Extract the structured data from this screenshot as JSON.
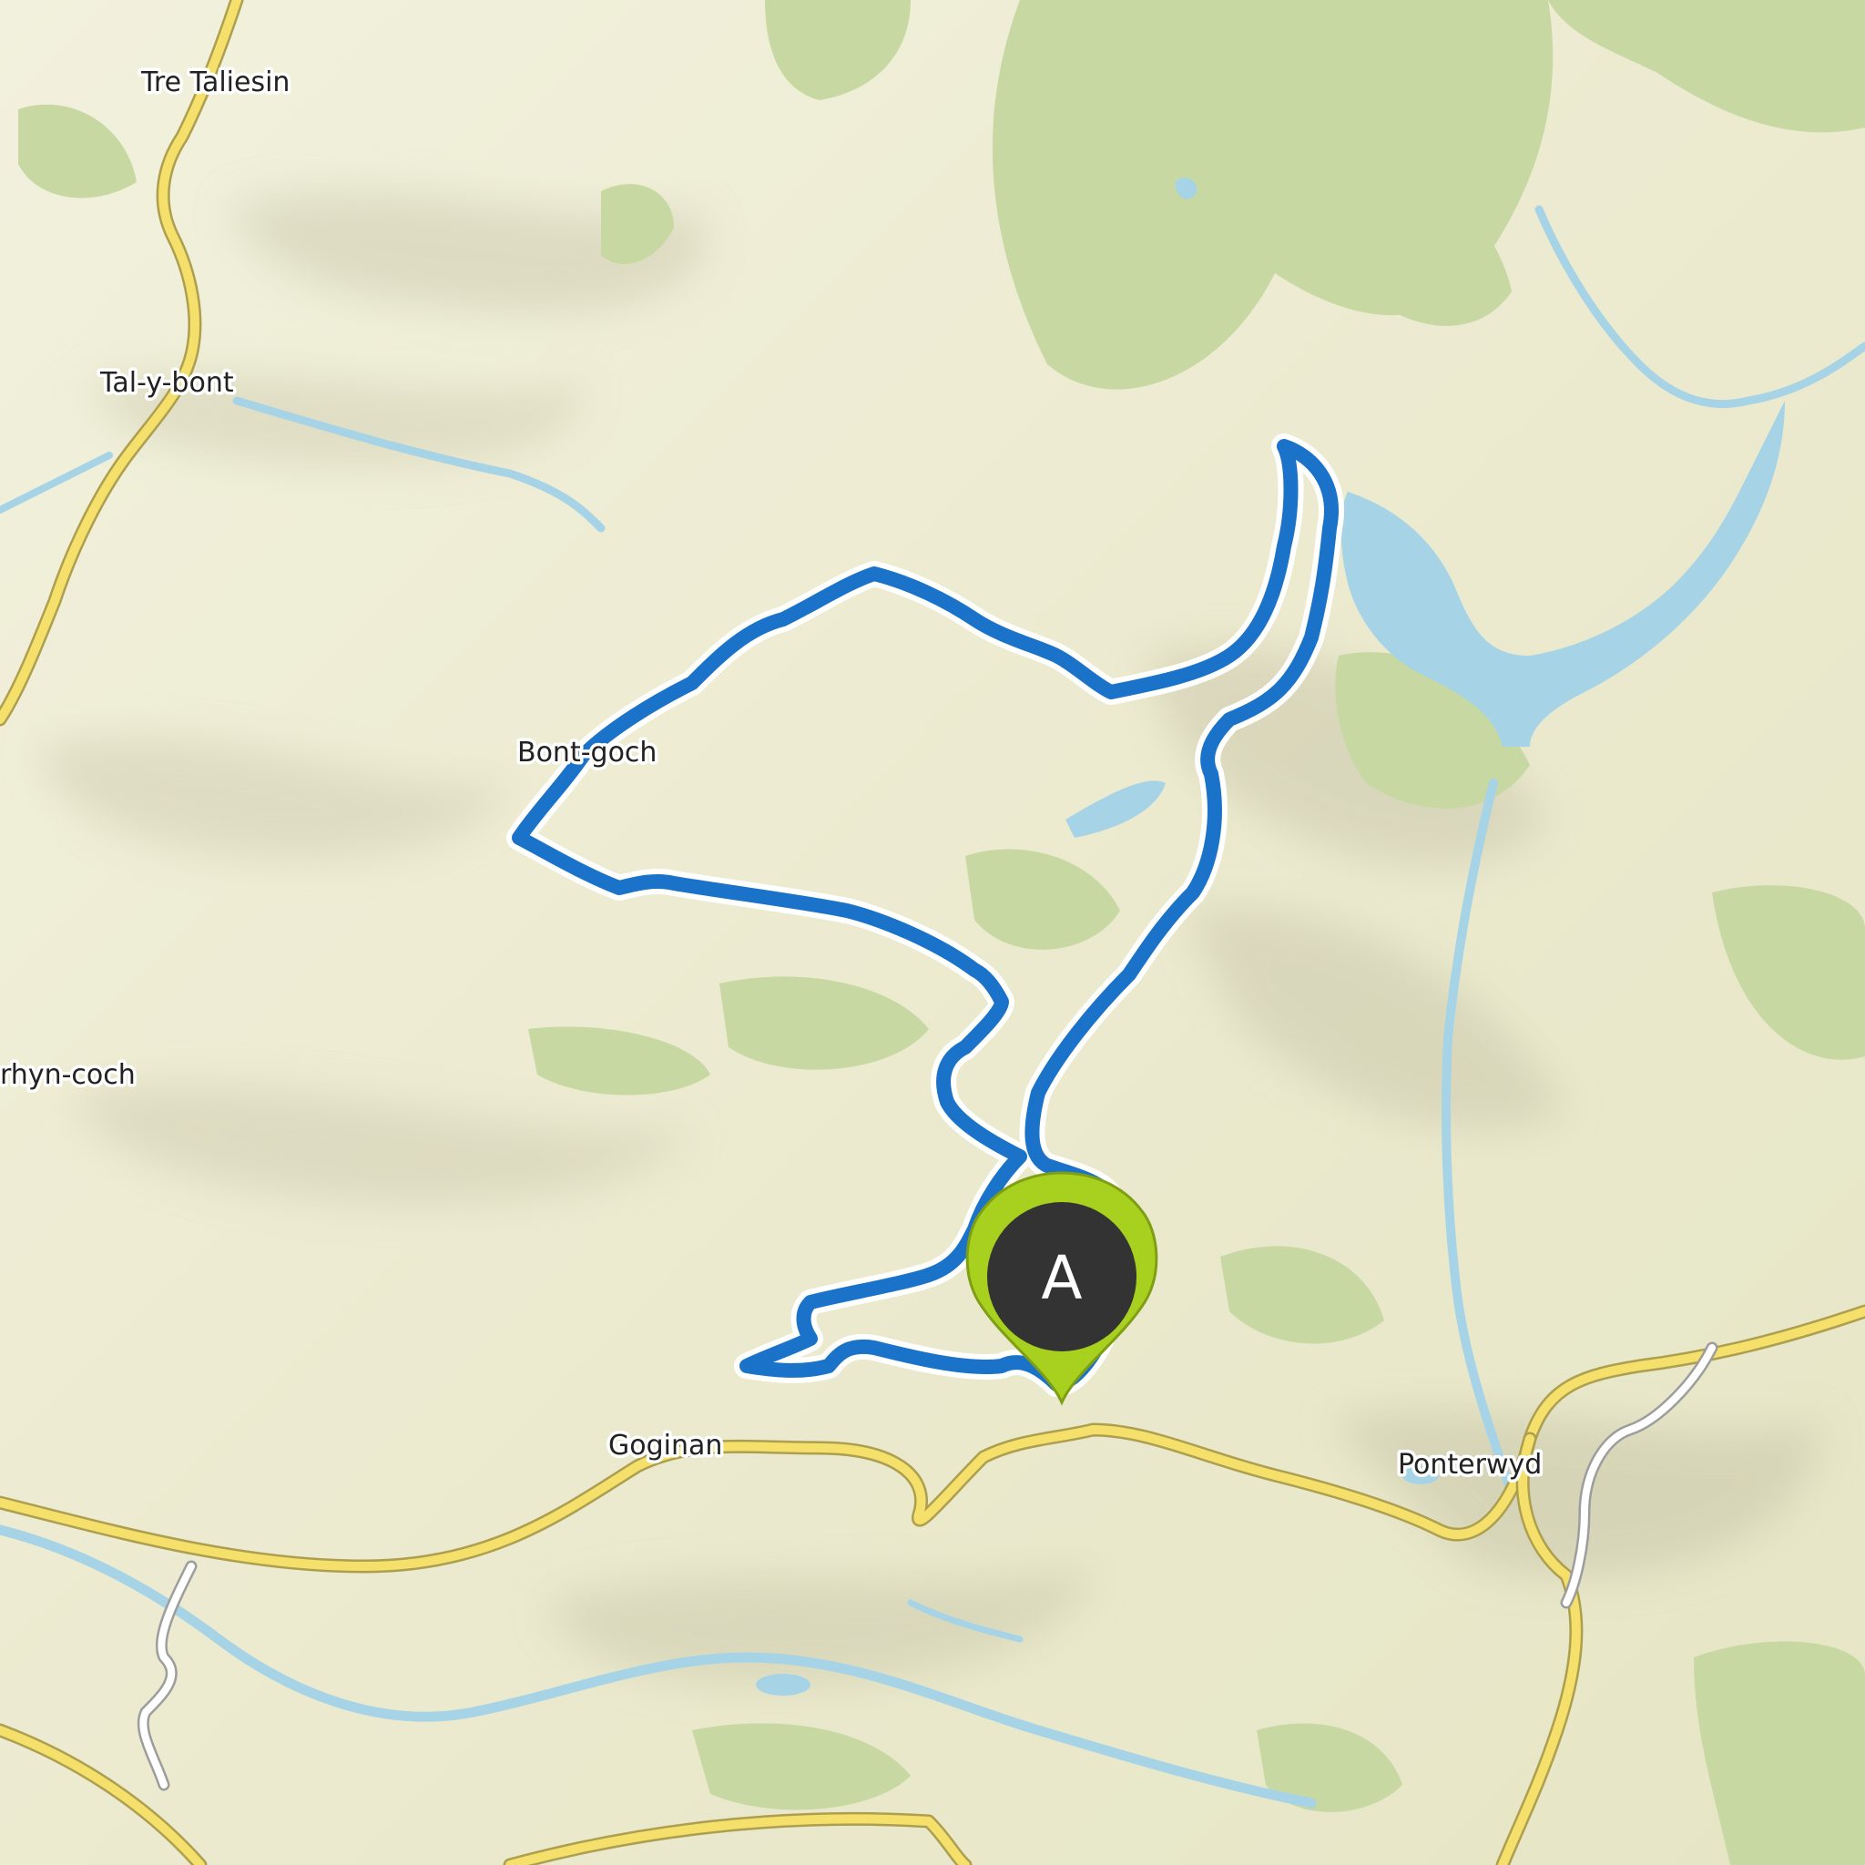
{
  "map": {
    "places": {
      "tre_taliesin": "Tre Taliesin",
      "tal_y_bont": "Tal-y-bont",
      "bont_goch": "Bont-goch",
      "rhyn_coch": "rhyn-coch",
      "goginan": "Goginan",
      "ponterwyd": "Ponterwyd"
    },
    "marker": {
      "label": "A",
      "color": "#a8d11f",
      "inner_color": "#333333"
    },
    "colors": {
      "route": "#1a73c8",
      "route_casing": "#ffffff",
      "water": "#a6d4e6",
      "forest": "#c8d8a2",
      "meadow": "#efeed9",
      "major_road": "#f4e06b",
      "minor_road": "#ffffff"
    }
  }
}
